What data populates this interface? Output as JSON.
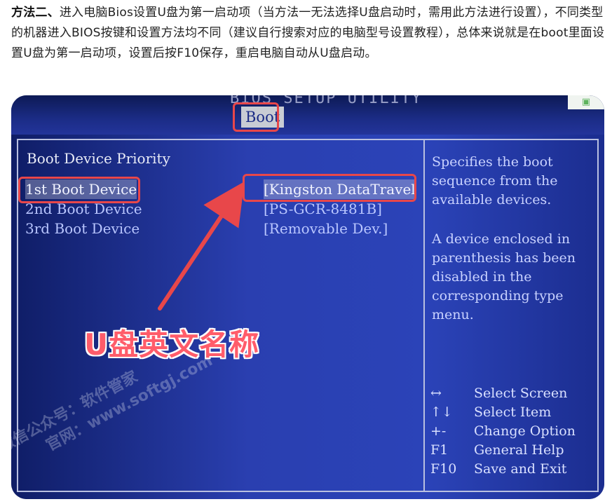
{
  "intro": {
    "bold_lead": "方法二、",
    "text": "进入电脑Bios设置U盘为第一启动项（当方法一无法选择U盘启动时，需用此方法进行设置），不同类型的机器进入BIOS按键和设置方法均不同（建议自行搜索对应的电脑型号设置教程），总体来说就是在boot里面设置U盘为第一启动项，设置后按F10保存，重启电脑自动从U盘启动。"
  },
  "bios": {
    "header_title": "BIOS SETUP UTILITY",
    "active_tab": "Boot",
    "section_title": "Boot Device Priority",
    "rows": [
      {
        "label": "1st Boot Device",
        "value": "[Kingston DataTravel"
      },
      {
        "label": "2nd Boot Device",
        "value": "[PS-GCR-8481B]"
      },
      {
        "label": "3rd Boot Device",
        "value": "[Removable Dev.]"
      }
    ],
    "help_top": "Specifies the boot sequence from the available devices.",
    "help_mid": "A device enclosed in parenthesis has been disabled in the corresponding type menu.",
    "keys": [
      {
        "key": "↔",
        "desc": "Select Screen"
      },
      {
        "key": "↑↓",
        "desc": "Select Item"
      },
      {
        "key": "+-",
        "desc": "Change Option"
      },
      {
        "key": "F1",
        "desc": "General Help"
      },
      {
        "key": "F10",
        "desc": "Save and Exit"
      }
    ]
  },
  "annotation": {
    "callout": "U盘英文名称",
    "arrow_color": "#e8474a"
  },
  "watermark": {
    "line1": "微信公众号：软件管家",
    "line2": "官网：www.softgj.com"
  }
}
